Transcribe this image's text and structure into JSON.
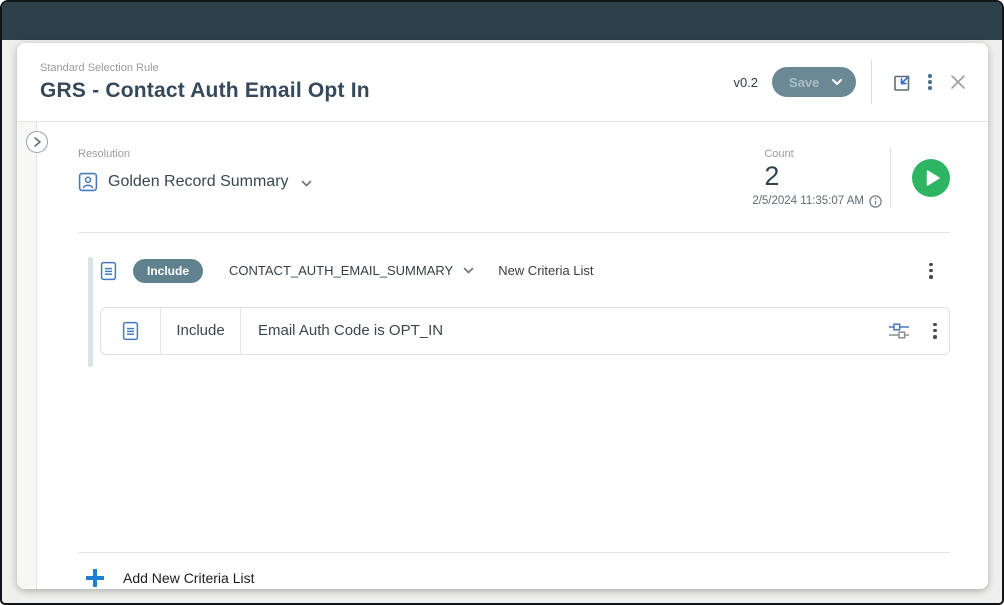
{
  "header": {
    "kicker": "Standard Selection Rule",
    "title": "GRS - Contact Auth Email Opt In",
    "version": "v0.2",
    "save_label": "Save"
  },
  "resolution": {
    "label": "Resolution",
    "value": "Golden Record Summary"
  },
  "count": {
    "label": "Count",
    "value": "2",
    "timestamp": "2/5/2024 11:35:07 AM"
  },
  "criteria_group": {
    "badge": "Include",
    "table": "CONTACT_AUTH_EMAIL_SUMMARY",
    "list_name": "New Criteria List",
    "rows": [
      {
        "operator": "Include",
        "description": "Email Auth Code is OPT_IN"
      }
    ]
  },
  "footer": {
    "add_button": "Add New Criteria List"
  },
  "icons": {
    "save_chevron": "chevron-down",
    "play": "run",
    "info": "info",
    "close": "close"
  },
  "colors": {
    "topbar": "#2c4049",
    "title_text": "#35495a",
    "save_button": "#6b8894",
    "include_pill": "#5f828e",
    "play_green": "#2db563",
    "icon_blue": "#4679bd",
    "accent_blue": "#1b7fd4",
    "group_bar": "#d9e4e8"
  }
}
